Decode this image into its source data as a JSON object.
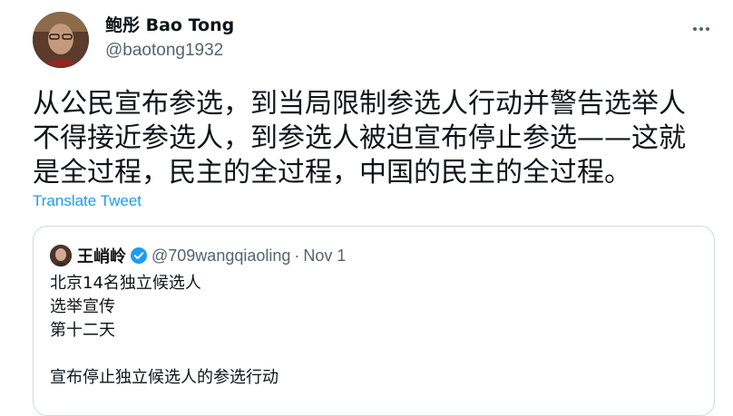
{
  "tweet": {
    "author": {
      "display_name": "鲍彤 Bao Tong",
      "handle": "@baotong1932"
    },
    "more_icon": "more-horizontal-icon",
    "text_lines": [
      "从公民宣布参选，到当局限制参选人行动并警告选举人",
      "不得接近参选人，到参选人被迫宣布停止参选——这就",
      "是全过程，民主的全过程，中国的民主的全过程。"
    ],
    "translate_label": "Translate Tweet"
  },
  "quoted": {
    "display_name": "王峭岭",
    "verified_icon": "verified-badge-icon",
    "handle": "@709wangqiaoling",
    "separator": "·",
    "date": "Nov 1",
    "body_lines": [
      "北京14名独立候选人",
      "选举宣传",
      "第十二天",
      "",
      "宣布停止独立候选人的参选行动"
    ]
  },
  "colors": {
    "link": "#1d9bf0",
    "secondary_text": "#536471",
    "border": "#cfd9de"
  }
}
